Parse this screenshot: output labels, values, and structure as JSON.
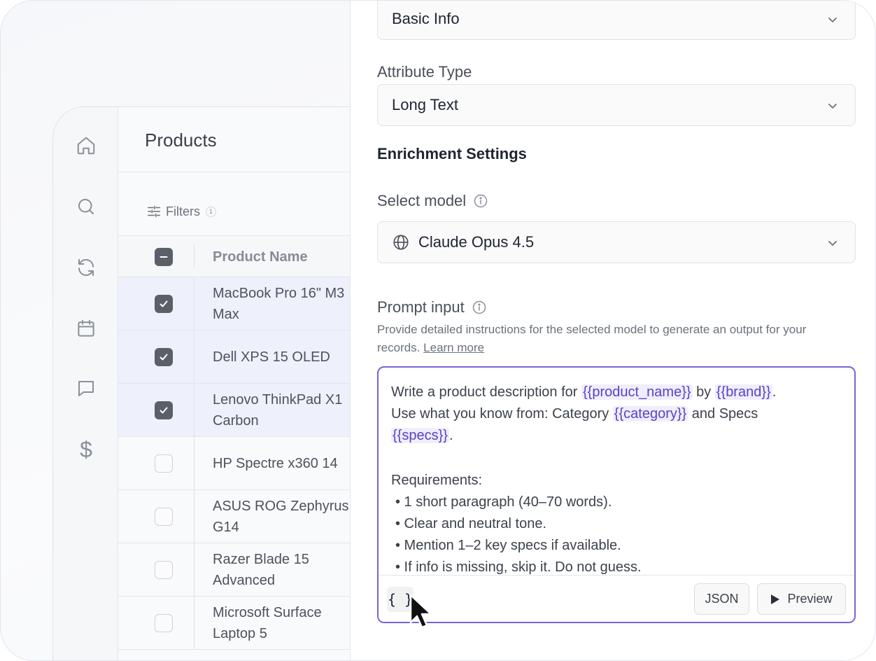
{
  "app": {
    "page_title": "Products",
    "filters_label": "Filters",
    "filters_count": "1",
    "table": {
      "column_header": "Product Name",
      "rows": [
        {
          "name": "MacBook Pro 16\" M3 Max",
          "selected": true
        },
        {
          "name": "Dell XPS 15 OLED",
          "selected": true
        },
        {
          "name": "Lenovo ThinkPad X1 Carbon",
          "selected": true
        },
        {
          "name": "HP Spectre x360 14",
          "selected": false
        },
        {
          "name": "ASUS ROG Zephyrus G14",
          "selected": false
        },
        {
          "name": "Razer Blade 15 Advanced",
          "selected": false
        },
        {
          "name": "Microsoft Surface Laptop 5",
          "selected": false
        }
      ]
    },
    "rail_icons": [
      "home-icon",
      "search-icon",
      "refresh-icon",
      "calendar-icon",
      "chat-icon",
      "dollar-icon"
    ]
  },
  "panel": {
    "group_select_value": "Basic Info",
    "attribute_type_label": "Attribute Type",
    "attribute_type_value": "Long Text",
    "enrichment_title": "Enrichment Settings",
    "select_model_label": "Select model",
    "model_value": "Claude Opus 4.5",
    "prompt_label": "Prompt input",
    "helper_text": "Provide detailed instructions for the selected model to generate an output for your records.",
    "learn_more": "Learn more",
    "prompt": {
      "line1_a": "Write a product description for ",
      "var_product_name": "{{product_name}}",
      "line1_b": " by ",
      "var_brand": "{{brand}}",
      "line1_c": ".",
      "line2_a": "Use what you know from: Category ",
      "var_category": "{{category}}",
      "line2_b": " and Specs",
      "var_specs": "{{specs}}",
      "line3_b": ".",
      "requirements": "Requirements:",
      "bullets": [
        "• 1 short paragraph (40–70 words).",
        "• Clear and neutral tone.",
        "• Mention 1–2 key specs if available.",
        "• If info is missing, skip it. Do not guess."
      ]
    },
    "brace_button": "{ }",
    "json_button": "JSON",
    "preview_button": "Preview"
  },
  "colors": {
    "accent": "#7a63d8",
    "variable_bg": "#f0edfc",
    "variable_text": "#5a42c4",
    "selected_row": "#eef1fb"
  }
}
